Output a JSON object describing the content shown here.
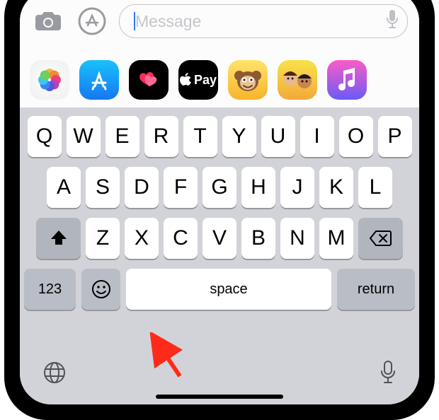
{
  "input": {
    "placeholder": "Message"
  },
  "apps": {
    "pay_label": "Pay"
  },
  "keyboard": {
    "row1": [
      "Q",
      "W",
      "E",
      "R",
      "T",
      "Y",
      "U",
      "I",
      "O",
      "P"
    ],
    "row2": [
      "A",
      "S",
      "D",
      "F",
      "G",
      "H",
      "J",
      "K",
      "L"
    ],
    "row3": [
      "Z",
      "X",
      "C",
      "V",
      "B",
      "N",
      "M"
    ],
    "numeric_label": "123",
    "space_label": "space",
    "return_label": "return"
  }
}
